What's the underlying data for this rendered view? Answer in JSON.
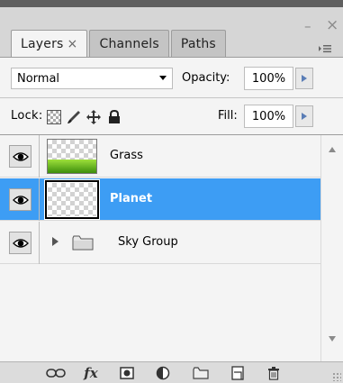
{
  "panel": {
    "window_controls": {
      "minimize": "–",
      "close": "×"
    },
    "tabs": [
      {
        "label": "Layers",
        "close": "×",
        "active": true
      },
      {
        "label": "Channels",
        "active": false
      },
      {
        "label": "Paths",
        "active": false
      }
    ],
    "menu_icon": "panel-menu-icon"
  },
  "blend": {
    "mode": "Normal",
    "opacity_label": "Opacity:",
    "opacity_value": "100%"
  },
  "lock": {
    "label": "Lock:",
    "icons": [
      "lock-transparent-pixels-icon",
      "lock-image-pixels-icon",
      "lock-position-icon",
      "lock-all-icon"
    ],
    "fill_label": "Fill:",
    "fill_value": "100%"
  },
  "layers": [
    {
      "name": "Grass",
      "visible": true,
      "selected": false,
      "type": "layer"
    },
    {
      "name": "Planet",
      "visible": true,
      "selected": true,
      "type": "layer"
    },
    {
      "name": "Sky Group",
      "visible": true,
      "selected": false,
      "type": "group",
      "expanded": false
    }
  ],
  "footer": {
    "icons": [
      "link-layers-icon",
      "layer-style-icon",
      "layer-mask-icon",
      "adjustment-layer-icon",
      "new-group-icon",
      "new-layer-icon",
      "delete-layer-icon"
    ],
    "fx_label": "fx"
  },
  "colors": {
    "selection": "#3d9df4",
    "grass_top": "#9ee03b",
    "grass_bottom": "#3c8e0c"
  }
}
